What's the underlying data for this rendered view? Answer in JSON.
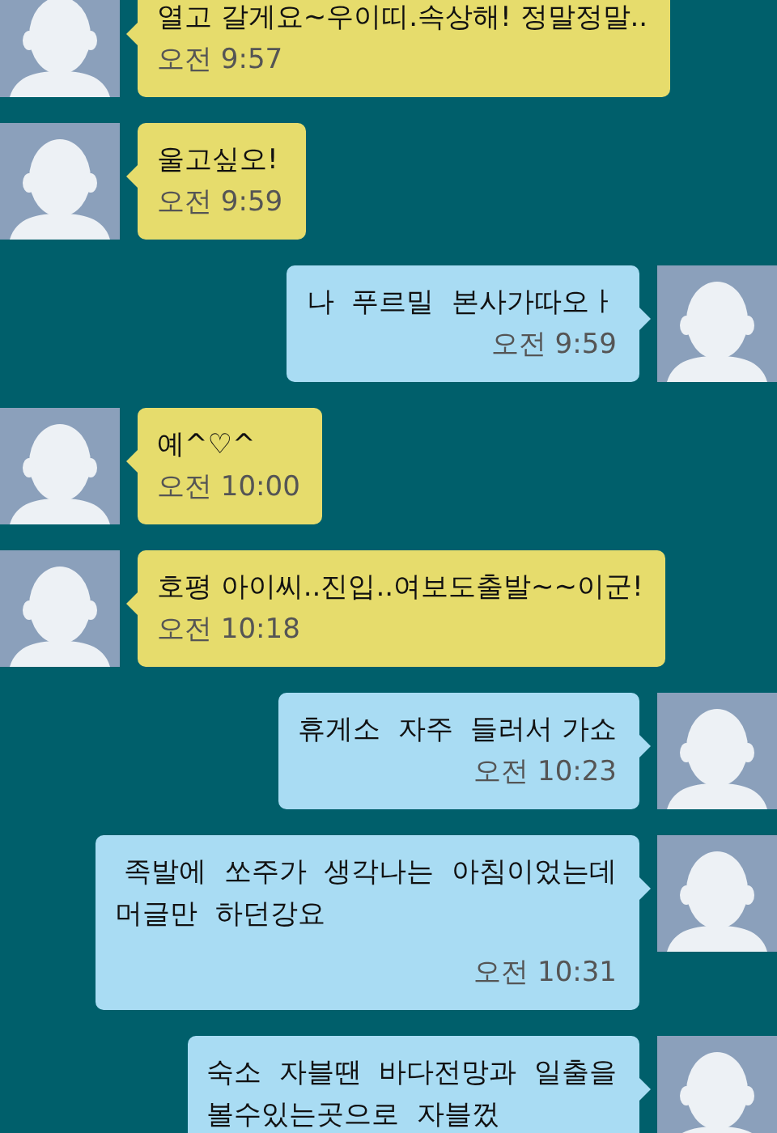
{
  "messages": [
    {
      "kind": "incoming",
      "lines": [
        "열고 갈게요~우이띠.속상해! 정말정말.."
      ],
      "time": "오전 9:57"
    },
    {
      "kind": "incoming",
      "lines": [
        "울고싶오!"
      ],
      "time": "오전 9:59"
    },
    {
      "kind": "outgoing",
      "lines": [
        "나  푸르밀  본사가따오ㅏ"
      ],
      "time": "오전 9:59"
    },
    {
      "kind": "incoming",
      "lines": [
        "예^♡^"
      ],
      "time": "오전 10:00"
    },
    {
      "kind": "incoming",
      "lines": [
        "호평 아이씨..진입..여보도출발~~이군!"
      ],
      "time": "오전 10:18"
    },
    {
      "kind": "outgoing",
      "lines": [
        "휴게소  자주  들러서 가쇼"
      ],
      "time": "오전 10:23"
    },
    {
      "kind": "outgoing",
      "lines": [
        " 족발에  쏘주가  생각나는  아침이었는데",
        "머글만  하던강요"
      ],
      "time": "오전 10:31"
    },
    {
      "kind": "outgoing",
      "lines": [
        "숙소  자블땐  바다전망과  일출을",
        "볼수있는곳으로  자블껐"
      ]
    }
  ]
}
